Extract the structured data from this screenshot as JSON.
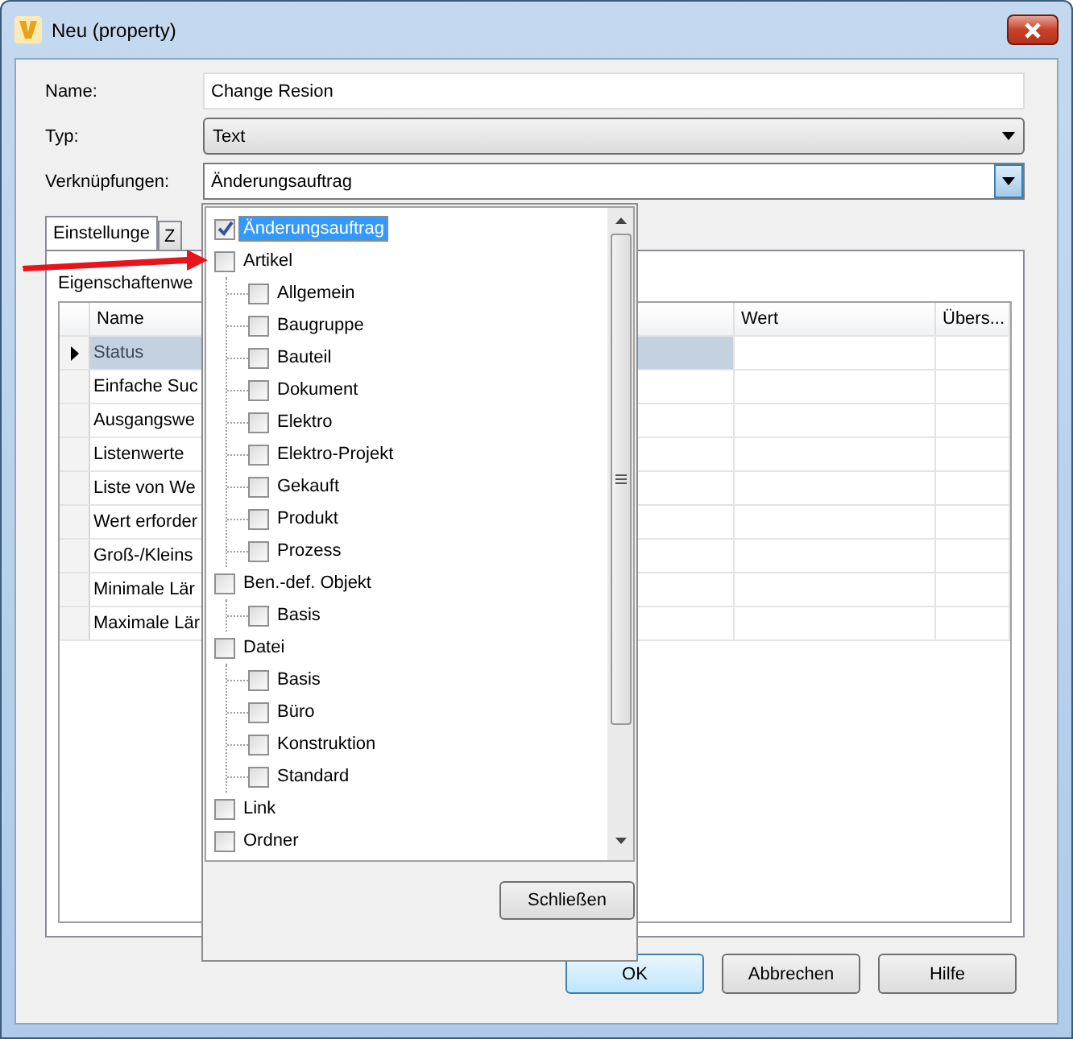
{
  "window": {
    "title": "Neu (property)"
  },
  "form": [
    {
      "label": "Name:",
      "kind": "text",
      "value": "Change Resion"
    },
    {
      "label": "Typ:",
      "kind": "combo",
      "value": "Text"
    },
    {
      "label": "Verknüpfungen:",
      "kind": "dropdown",
      "value": "Änderungsauftrag"
    }
  ],
  "tabs": [
    {
      "label": "Einstellunge",
      "selected": true
    },
    {
      "label": "Z",
      "selected": false
    }
  ],
  "section_label": "Eigenschaftenwe",
  "table": {
    "columns": [
      "Name",
      "Wert",
      "Übers..."
    ],
    "rows": [
      {
        "name": "Status",
        "selected": true
      },
      {
        "name": "Einfache Suc",
        "selected": false
      },
      {
        "name": "Ausgangswe",
        "selected": false
      },
      {
        "name": "Listenwerte",
        "selected": false
      },
      {
        "name": "Liste von We",
        "selected": false
      },
      {
        "name": "Wert erforder",
        "selected": false
      },
      {
        "name": "Groß-/Kleins",
        "selected": false
      },
      {
        "name": "Minimale Lär",
        "selected": false
      },
      {
        "name": "Maximale Lär",
        "selected": false
      }
    ]
  },
  "popup": {
    "items": [
      {
        "label": "Änderungsauftrag",
        "checked": true,
        "selected": true
      },
      {
        "label": "Artikel",
        "checked": false,
        "selected": false,
        "children": [
          {
            "label": "Allgemein",
            "checked": false,
            "selected": false
          },
          {
            "label": "Baugruppe",
            "checked": false,
            "selected": false
          },
          {
            "label": "Bauteil",
            "checked": false,
            "selected": false
          },
          {
            "label": "Dokument",
            "checked": false,
            "selected": false
          },
          {
            "label": "Elektro",
            "checked": false,
            "selected": false
          },
          {
            "label": "Elektro-Projekt",
            "checked": false,
            "selected": false
          },
          {
            "label": "Gekauft",
            "checked": false,
            "selected": false
          },
          {
            "label": "Produkt",
            "checked": false,
            "selected": false
          },
          {
            "label": "Prozess",
            "checked": false,
            "selected": false
          }
        ]
      },
      {
        "label": "Ben.-def. Objekt",
        "checked": false,
        "selected": false,
        "children": [
          {
            "label": "Basis",
            "checked": false,
            "selected": false
          }
        ]
      },
      {
        "label": "Datei",
        "checked": false,
        "selected": false,
        "children": [
          {
            "label": "Basis",
            "checked": false,
            "selected": false
          },
          {
            "label": "Büro",
            "checked": false,
            "selected": false
          },
          {
            "label": "Konstruktion",
            "checked": false,
            "selected": false
          },
          {
            "label": "Standard",
            "checked": false,
            "selected": false
          }
        ]
      },
      {
        "label": "Link",
        "checked": false,
        "selected": false
      },
      {
        "label": "Ordner",
        "checked": false,
        "selected": false
      }
    ],
    "close_button": "Schließen"
  },
  "buttons": [
    {
      "label": "OK",
      "default": true
    },
    {
      "label": "Abbrechen",
      "default": false
    },
    {
      "label": "Hilfe",
      "default": false
    }
  ]
}
